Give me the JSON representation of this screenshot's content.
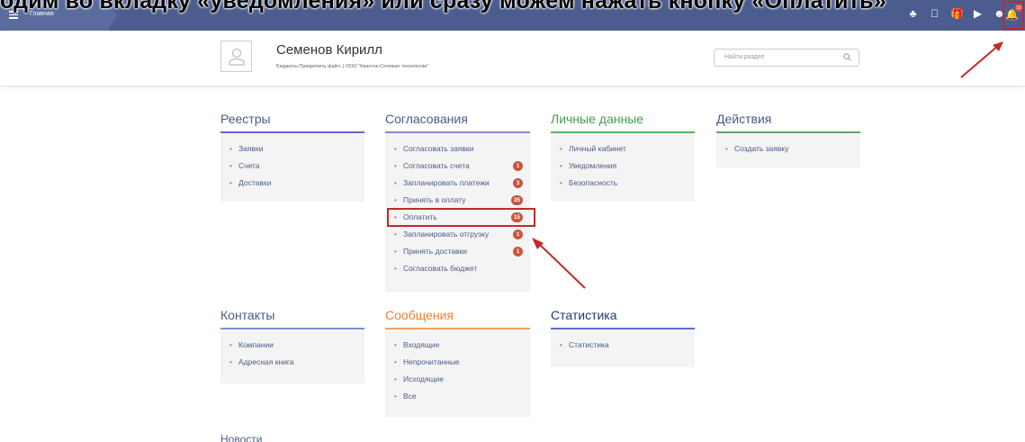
{
  "header": {
    "breadcrumb": "Главная",
    "overlay_caption": "одим во вкладку «уведомления» или сразу можем нажать кнопку «Оплатить»",
    "notification_count": "10"
  },
  "user": {
    "name": "Семенов Кирилл",
    "subtitle": "Бюджеты.Прикрепить файл. | ООО \"Квантек-Сетевые технологии\""
  },
  "search": {
    "placeholder": "Найти раздел"
  },
  "sections": {
    "registries": {
      "title": "Реестры",
      "items": [
        "Заявки",
        "Счета",
        "Доставки"
      ]
    },
    "approvals": {
      "title": "Согласования",
      "items": [
        "Согласовать заявки",
        "Согласовать счета",
        "Запланировать платежи",
        "Принять в оплату",
        "Оплатить",
        "Запланировать отгрузку",
        "Принять доставки",
        "Согласовать бюджет"
      ],
      "badges": [
        "",
        "1",
        "3",
        "35",
        "15",
        "1",
        "1",
        ""
      ]
    },
    "personal": {
      "title": "Личные данные",
      "items": [
        "Личный кабинет",
        "Уведомления",
        "Безопасность"
      ]
    },
    "actions": {
      "title": "Действия",
      "items": [
        "Создать заявку"
      ]
    },
    "contacts": {
      "title": "Контакты",
      "items": [
        "Компании",
        "Адресная книга"
      ]
    },
    "messages": {
      "title": "Сообщения",
      "items": [
        "Входящие",
        "Непрочитанные",
        "Исходящие",
        "Все"
      ]
    },
    "statistics": {
      "title": "Статистика",
      "items": [
        "Статистика"
      ]
    },
    "news": {
      "title": "Новости"
    }
  },
  "colors": {
    "topbar": "#4b5d8e",
    "registries": "#4a5b89",
    "approvals": "#4a5b89",
    "personal": "#3f9e4c",
    "actions": "#4a5b89",
    "contacts": "#4a5b89",
    "messages": "#e8823a",
    "statistics": "#223a7a",
    "rule_registries": "#7d5bc9",
    "rule_approvals": "#9c7fd6",
    "rule_personal": "#52b85e",
    "rule_actions": "#57a866",
    "rule_contacts": "#7d8fd6",
    "rule_messages": "#f0a262",
    "rule_statistics": "#5a6bd8",
    "annotation": "#c02a2a",
    "badge": "#c9563e"
  }
}
